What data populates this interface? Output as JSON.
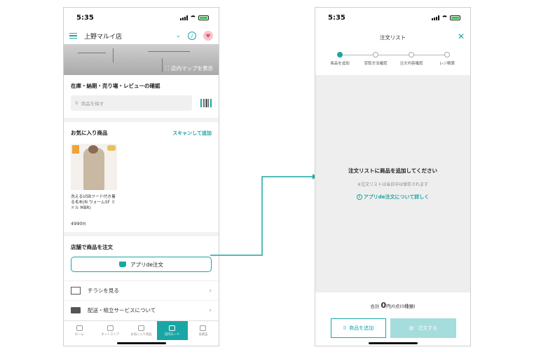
{
  "colors": {
    "accent": "#1aa6a4",
    "heart": "#e8557a",
    "battery": "#35c24a",
    "disabled_button": "#a5dcdc"
  },
  "left_screen": {
    "status": {
      "time": "5:35"
    },
    "header": {
      "store_name": "上野マルイ店",
      "chevron_icon": "chevron-down-icon",
      "info_icon": "info-icon",
      "heart_icon": "heart-icon"
    },
    "map_banner": {
      "button_label": "店内マップを表示"
    },
    "inventory": {
      "title": "在庫・納期・売り場・レビューの確認",
      "search_placeholder": "商品を探す"
    },
    "favorites": {
      "title": "お気に入り商品",
      "scan_link": "スキャンして追加",
      "product": {
        "name": "洗えるUSBフード付き着る毛布(N ウォームSF ミドル MBR)",
        "price": "4990",
        "price_unit": "円"
      }
    },
    "store_order": {
      "title": "店舗で商品を注文",
      "button_label": "アプリde注文"
    },
    "menu": [
      {
        "label": "チラシを見る",
        "icon": "flyer-icon"
      },
      {
        "label": "配送・組立サービスについて",
        "icon": "truck-icon"
      }
    ],
    "tabs": [
      {
        "label": "ホーム",
        "icon": "home-icon",
        "active": false
      },
      {
        "label": "ネットストア",
        "icon": "cart-icon",
        "active": false
      },
      {
        "label": "お気に入り商品",
        "icon": "heart-icon",
        "active": false
      },
      {
        "label": "店内モード",
        "icon": "store-icon",
        "active": true
      },
      {
        "label": "会員証",
        "icon": "member-card-icon",
        "active": false
      }
    ]
  },
  "right_screen": {
    "status": {
      "time": "5:35"
    },
    "header": {
      "title": "注文リスト",
      "close_icon": "close-icon"
    },
    "steps": [
      {
        "label": "商品を追加",
        "active": true
      },
      {
        "label": "受取方法確認",
        "active": false
      },
      {
        "label": "注文内容確認",
        "active": false
      },
      {
        "label": "レジ精算",
        "active": false
      }
    ],
    "empty": {
      "title": "注文リストに商品を追加してください",
      "note": "※注文リストは当日中は保存されます",
      "link": "アプリde注文について詳しく"
    },
    "total": {
      "label": "合計",
      "amount": "0",
      "unit_text": "円/0点(0種類)"
    },
    "buttons": {
      "add_label": "商品を追加",
      "order_label": "注文する"
    }
  }
}
